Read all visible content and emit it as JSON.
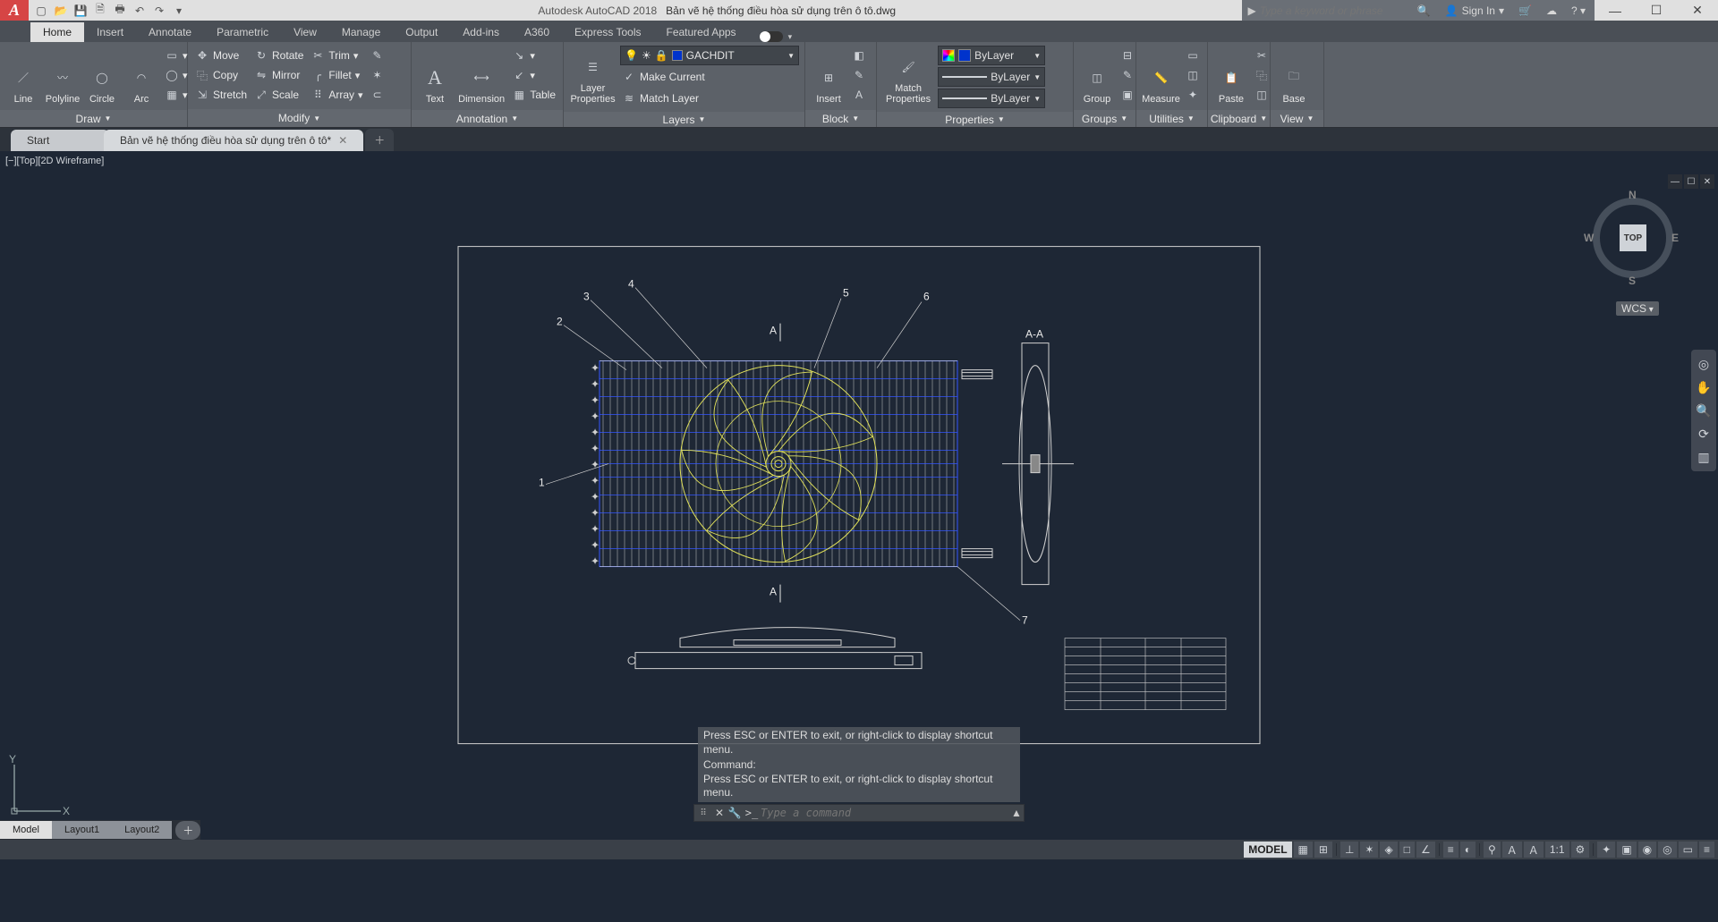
{
  "titlebar": {
    "logo": "A",
    "app": "Autodesk AutoCAD 2018",
    "file": "Bản vẽ hệ thống điều hòa sử dụng trên ô tô.dwg",
    "search_placeholder": "Type a keyword or phrase",
    "signin": "Sign In"
  },
  "ribbon_tabs": {
    "items": [
      "Home",
      "Insert",
      "Annotate",
      "Parametric",
      "View",
      "Manage",
      "Output",
      "Add-ins",
      "A360",
      "Express Tools",
      "Featured Apps"
    ],
    "active": "Home"
  },
  "ribbon": {
    "draw": {
      "footer": "Draw",
      "line": "Line",
      "polyline": "Polyline",
      "circle": "Circle",
      "arc": "Arc"
    },
    "modify": {
      "footer": "Modify",
      "move": "Move",
      "copy": "Copy",
      "stretch": "Stretch",
      "rotate": "Rotate",
      "mirror": "Mirror",
      "scale": "Scale",
      "trim": "Trim",
      "fillet": "Fillet",
      "array": "Array"
    },
    "annotation": {
      "footer": "Annotation",
      "text": "Text",
      "dimension": "Dimension",
      "table": "Table"
    },
    "layers": {
      "footer": "Layers",
      "properties": "Layer\nProperties",
      "current_layer": "GACHDIT",
      "make_current": "Make Current",
      "match_layer": "Match Layer"
    },
    "block": {
      "footer": "Block",
      "insert": "Insert"
    },
    "properties": {
      "footer": "Properties",
      "match": "Match\nProperties",
      "color": "ByLayer",
      "lineweight": "ByLayer",
      "linetype": "ByLayer"
    },
    "groups": {
      "footer": "Groups",
      "group": "Group"
    },
    "utilities": {
      "footer": "Utilities",
      "measure": "Measure"
    },
    "clipboard": {
      "footer": "Clipboard",
      "paste": "Paste"
    },
    "view": {
      "footer": "View",
      "base": "Base"
    }
  },
  "file_tabs": {
    "start": "Start",
    "doc": "Bản vẽ hệ thống điều hòa sử dụng trên ô tô*"
  },
  "viewport_label": "[−][Top][2D Wireframe]",
  "viewcube": {
    "top": "TOP",
    "n": "N",
    "s": "S",
    "e": "E",
    "w": "W",
    "wcs": "WCS"
  },
  "ucs": {
    "x": "X",
    "y": "Y"
  },
  "drawing": {
    "section_a_top": "A",
    "section_a_bottom": "A",
    "section_aa": "A-A",
    "callouts": [
      "1",
      "2",
      "3",
      "4",
      "5",
      "6",
      "7"
    ]
  },
  "command": {
    "history1": "Press ESC or ENTER to exit, or right-click to display shortcut menu.",
    "history2": "Command:",
    "history3": "Press ESC or ENTER to exit, or right-click to display shortcut menu.",
    "placeholder": "Type a command",
    "prompt": ">_"
  },
  "layout_tabs": {
    "model": "Model",
    "l1": "Layout1",
    "l2": "Layout2"
  },
  "status": {
    "model": "MODEL",
    "scale": "1:1"
  }
}
